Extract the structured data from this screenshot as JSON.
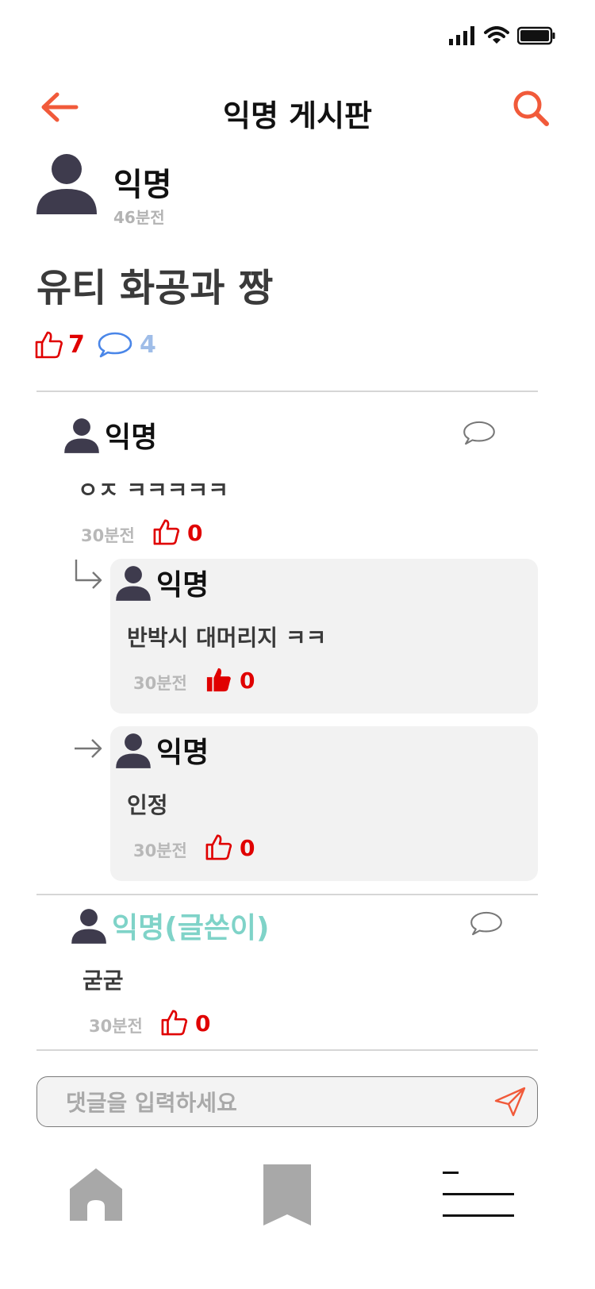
{
  "header": {
    "title": "익명 게시판",
    "back_icon": "arrow-left-icon",
    "search_icon": "search-icon"
  },
  "post": {
    "author": "익명",
    "time": "46분전",
    "title": "유티 화공과 짱",
    "likes": "7",
    "comments": "4"
  },
  "comments": [
    {
      "author": "익명",
      "text": "ㅇㅈ ㅋㅋㅋㅋㅋ",
      "time": "30분전",
      "likes": "0",
      "replies": [
        {
          "author": "익명",
          "text": "반박시 대머리지 ㅋㅋ",
          "time": "30분전",
          "likes": "0",
          "liked": true
        },
        {
          "author": "익명",
          "text": "인정",
          "time": "30분전",
          "likes": "0",
          "liked": false
        }
      ]
    },
    {
      "author": "익명(글쓴이)",
      "text": "굳굳",
      "time": "30분전",
      "likes": "0"
    }
  ],
  "comment_input": {
    "placeholder": "댓글을 입력하세요"
  },
  "colors": {
    "accent": "#f15a3a",
    "like_red": "#e00000",
    "writer_teal": "#7fd3c8",
    "comment_blue": "#4a86e8",
    "avatar": "#3e3b4d"
  },
  "bottom_nav": [
    "home-icon",
    "bookmark-icon",
    "menu-icon"
  ]
}
